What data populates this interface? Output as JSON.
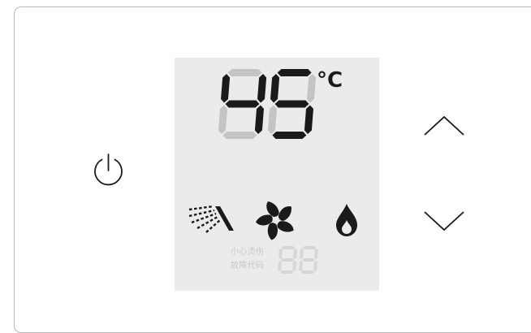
{
  "display": {
    "temperature": "45",
    "unit": "°C",
    "fault_code": "88",
    "hint_scald": "小心烫伤",
    "hint_fault": "故障代码"
  },
  "icons": {
    "power": "power-icon",
    "shower": "shower-icon",
    "fan": "fan-icon",
    "flame": "flame-icon",
    "up": "chevron-up-icon",
    "down": "chevron-down-icon"
  },
  "colors": {
    "lcd_background": "#ebebeb",
    "segment_on": "#1a1a1a",
    "segment_off": "#c4c4c4",
    "fault_segment": "#d6d6d6",
    "panel_border": "#b9b9b9"
  }
}
